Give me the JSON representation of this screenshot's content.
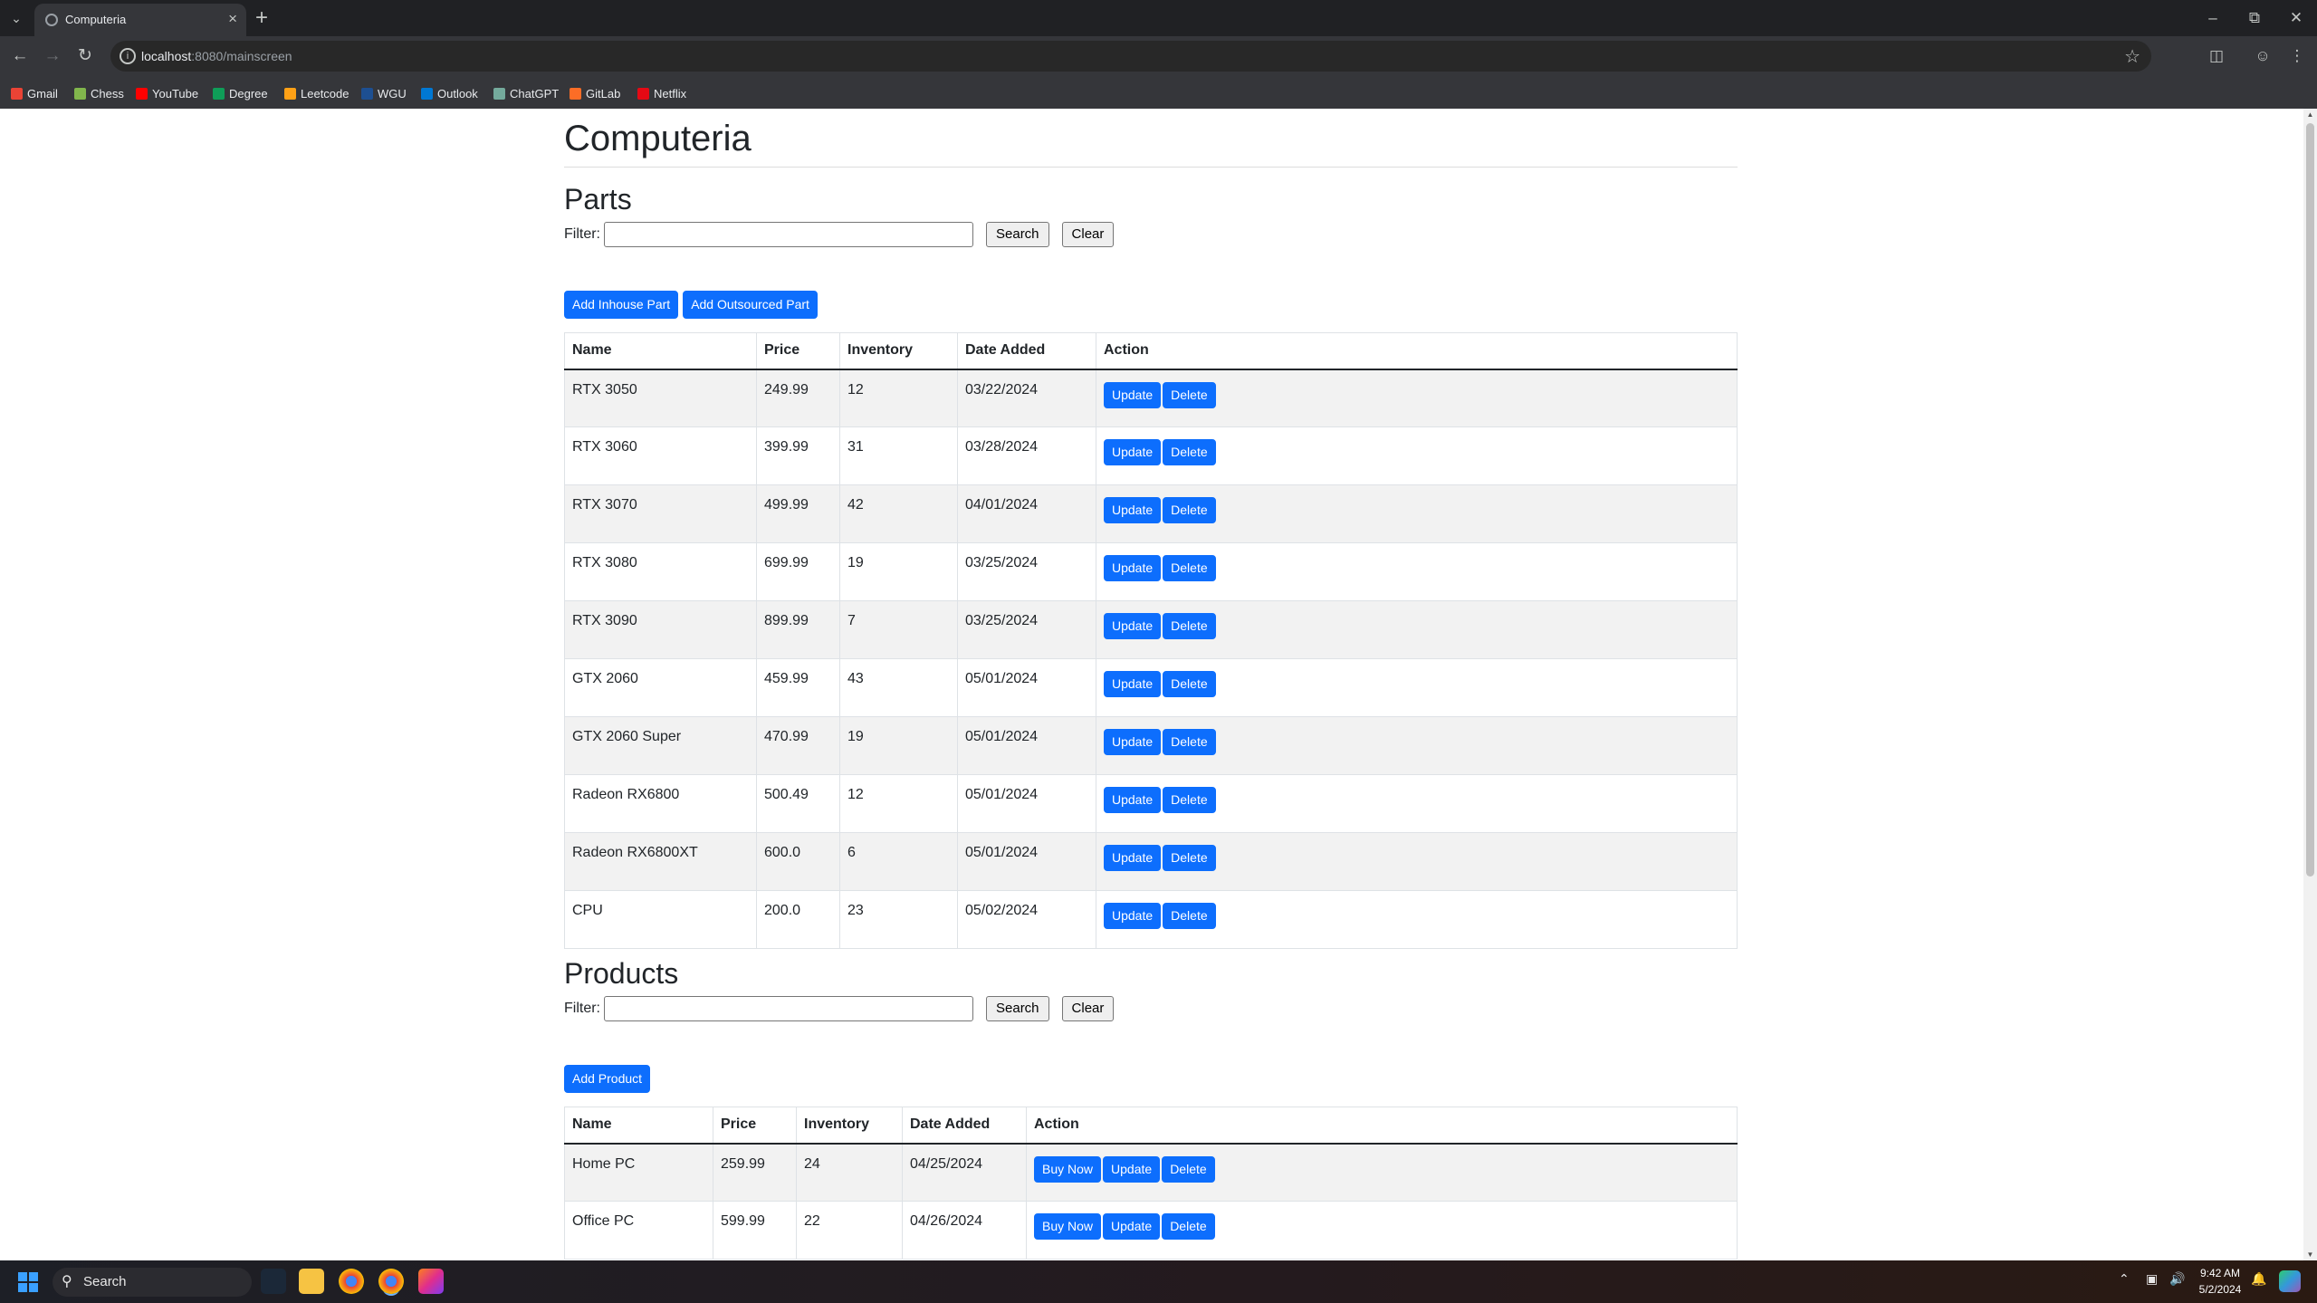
{
  "browser": {
    "tab_title": "Computeria",
    "url_host": "localhost",
    "url_rest": ":8080/mainscreen",
    "bookmarks": [
      {
        "label": "Gmail",
        "color": "#ea4335"
      },
      {
        "label": "Chess",
        "color": "#81b64c"
      },
      {
        "label": "YouTube",
        "color": "#ff0000"
      },
      {
        "label": "Degree",
        "color": "#0f9d58"
      },
      {
        "label": "Leetcode",
        "color": "#ffa116"
      },
      {
        "label": "WGU",
        "color": "#003057"
      },
      {
        "label": "Outlook",
        "color": "#0078d4"
      },
      {
        "label": "ChatGPT",
        "color": "#74aa9c"
      },
      {
        "label": "GitLab",
        "color": "#fc6d26"
      },
      {
        "label": "Netflix",
        "color": "#e50914"
      }
    ]
  },
  "page": {
    "title": "Computeria",
    "parts": {
      "heading": "Parts",
      "filter_label": "Filter:",
      "search_label": "Search",
      "clear_label": "Clear",
      "add_inhouse_label": "Add Inhouse Part",
      "add_outsourced_label": "Add Outsourced Part",
      "columns": [
        "Name",
        "Price",
        "Inventory",
        "Date Added",
        "Action"
      ],
      "rows": [
        {
          "name": "RTX 3050",
          "price": "249.99",
          "inventory": "12",
          "date": "03/22/2024"
        },
        {
          "name": "RTX 3060",
          "price": "399.99",
          "inventory": "31",
          "date": "03/28/2024"
        },
        {
          "name": "RTX 3070",
          "price": "499.99",
          "inventory": "42",
          "date": "04/01/2024"
        },
        {
          "name": "RTX 3080",
          "price": "699.99",
          "inventory": "19",
          "date": "03/25/2024"
        },
        {
          "name": "RTX 3090",
          "price": "899.99",
          "inventory": "7",
          "date": "03/25/2024"
        },
        {
          "name": "GTX 2060",
          "price": "459.99",
          "inventory": "43",
          "date": "05/01/2024"
        },
        {
          "name": "GTX 2060 Super",
          "price": "470.99",
          "inventory": "19",
          "date": "05/01/2024"
        },
        {
          "name": "Radeon RX6800",
          "price": "500.49",
          "inventory": "12",
          "date": "05/01/2024"
        },
        {
          "name": "Radeon RX6800XT",
          "price": "600.0",
          "inventory": "6",
          "date": "05/01/2024"
        },
        {
          "name": "CPU",
          "price": "200.0",
          "inventory": "23",
          "date": "05/02/2024"
        }
      ],
      "update_label": "Update",
      "delete_label": "Delete"
    },
    "products": {
      "heading": "Products",
      "filter_label": "Filter:",
      "search_label": "Search",
      "clear_label": "Clear",
      "add_product_label": "Add Product",
      "columns": [
        "Name",
        "Price",
        "Inventory",
        "Date Added",
        "Action"
      ],
      "rows": [
        {
          "name": "Home PC",
          "price": "259.99",
          "inventory": "24",
          "date": "04/25/2024"
        },
        {
          "name": "Office PC",
          "price": "599.99",
          "inventory": "22",
          "date": "04/26/2024"
        }
      ],
      "buy_label": "Buy Now",
      "update_label": "Update",
      "delete_label": "Delete"
    }
  },
  "taskbar": {
    "search_label": "Search",
    "time": "9:42 AM",
    "date": "5/2/2024"
  },
  "colors": {
    "primary": "#0d6efd",
    "chrome_dark": "#202124",
    "chrome_mid": "#35363a"
  }
}
